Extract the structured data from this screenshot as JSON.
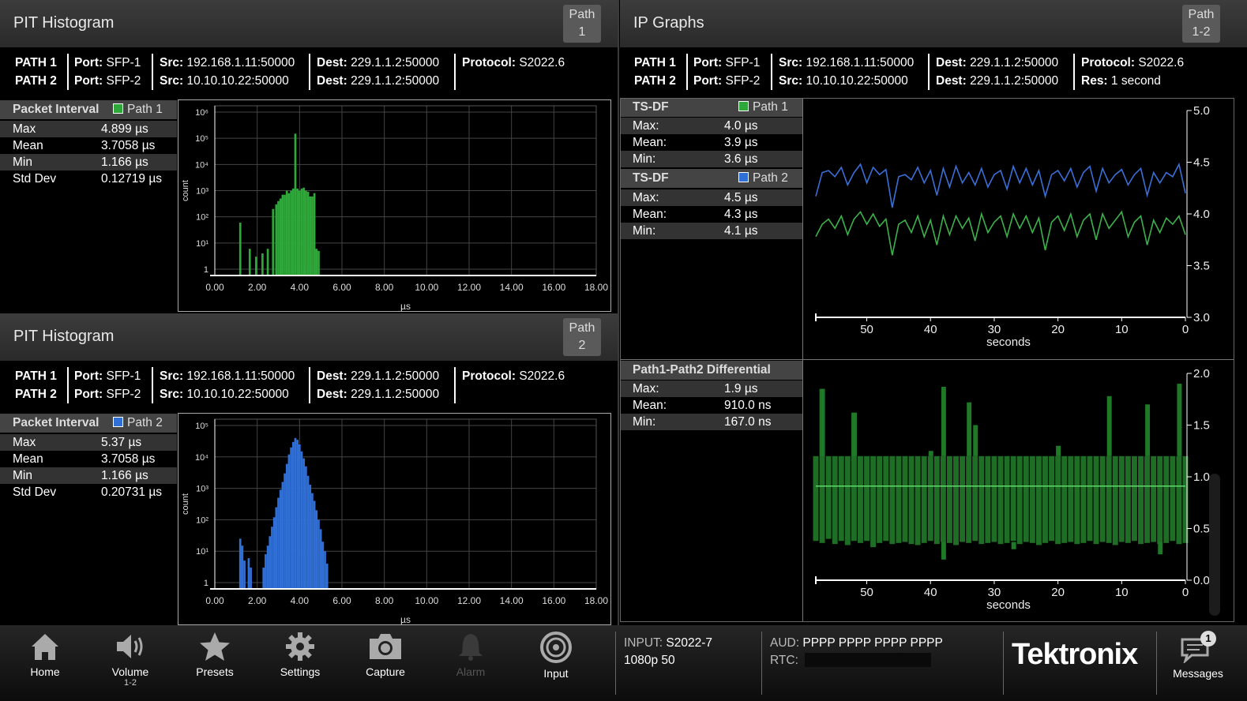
{
  "hist1": {
    "title": "PIT Histogram",
    "path_btn": [
      "Path",
      "1"
    ],
    "info": {
      "p1": {
        "path": "PATH 1",
        "port": "SFP-1",
        "src": "192.168.1.11:50000",
        "dest": "229.1.1.2:50000",
        "extra_label": "Protocol:",
        "extra": "S2022.6"
      },
      "p2": {
        "path": "PATH 2",
        "port": "SFP-2",
        "src": "10.10.10.22:50000",
        "dest": "229.1.1.2:50000"
      }
    },
    "stats_header": "Packet Interval",
    "stats_path": "Path 1",
    "stats": [
      {
        "label": "Max",
        "value": "4.899 µs"
      },
      {
        "label": "Mean",
        "value": "3.7058 µs"
      },
      {
        "label": "Min",
        "value": "1.166 µs"
      },
      {
        "label": "Std Dev",
        "value": "0.12719 µs"
      }
    ]
  },
  "hist2": {
    "title": "PIT Histogram",
    "path_btn": [
      "Path",
      "2"
    ],
    "info": {
      "p1": {
        "path": "PATH 1",
        "port": "SFP-1",
        "src": "192.168.1.11:50000",
        "dest": "229.1.1.2:50000",
        "extra_label": "Protocol:",
        "extra": "S2022.6"
      },
      "p2": {
        "path": "PATH 2",
        "port": "SFP-2",
        "src": "10.10.10.22:50000",
        "dest": "229.1.1.2:50000"
      }
    },
    "stats_header": "Packet Interval",
    "stats_path": "Path 2",
    "stats": [
      {
        "label": "Max",
        "value": "5.37 µs"
      },
      {
        "label": "Mean",
        "value": "3.7058 µs"
      },
      {
        "label": "Min",
        "value": "1.166 µs"
      },
      {
        "label": "Std Dev",
        "value": "0.20731 µs"
      }
    ]
  },
  "ipgraphs": {
    "title": "IP Graphs",
    "path_btn": [
      "Path",
      "1-2"
    ],
    "info": {
      "p1": {
        "path": "PATH 1",
        "port": "SFP-1",
        "src": "192.168.1.11:50000",
        "dest": "229.1.1.2:50000",
        "extra_label": "Protocol:",
        "extra": "S2022.6"
      },
      "p2": {
        "path": "PATH 2",
        "port": "SFP-2",
        "src": "10.10.10.22:50000",
        "dest": "229.1.1.2:50000",
        "extra_label": "Res:",
        "extra": "1 second"
      }
    },
    "tsdf1": {
      "header": "TS-DF",
      "path": "Path 1",
      "stats": [
        {
          "label": "Max:",
          "value": "4.0 µs"
        },
        {
          "label": "Mean:",
          "value": "3.9 µs"
        },
        {
          "label": "Min:",
          "value": "3.6 µs"
        }
      ]
    },
    "tsdf2": {
      "header": "TS-DF",
      "path": "Path 2",
      "stats": [
        {
          "label": "Max:",
          "value": "4.5 µs"
        },
        {
          "label": "Mean:",
          "value": "4.3 µs"
        },
        {
          "label": "Min:",
          "value": "4.1 µs"
        }
      ]
    },
    "diff": {
      "header": "Path1-Path2 Differential",
      "stats": [
        {
          "label": "Max:",
          "value": "1.9 µs"
        },
        {
          "label": "Mean:",
          "value": "910.0 ns"
        },
        {
          "label": "Min:",
          "value": "167.0 ns"
        }
      ]
    }
  },
  "chart_data": [
    {
      "type": "bar",
      "id": "pit-histogram-path1",
      "xlabel": "µs",
      "ylabel": "count",
      "xlim": [
        0,
        18
      ],
      "yscale": "log",
      "ylim": [
        1,
        1000000
      ],
      "xticks": [
        "0.00",
        "2.00",
        "4.00",
        "6.00",
        "8.00",
        "10.00",
        "12.00",
        "14.00",
        "16.00",
        "18.00"
      ],
      "yticks": [
        "1",
        "10¹",
        "10²",
        "10³",
        "10⁴",
        "10⁵",
        "10⁶"
      ],
      "color": "#2fa83a",
      "x": [
        1.2,
        1.65,
        1.95,
        2.25,
        2.5,
        2.75,
        2.9,
        3.0,
        3.1,
        3.2,
        3.3,
        3.4,
        3.5,
        3.6,
        3.7,
        3.8,
        3.9,
        4.0,
        4.1,
        4.2,
        4.3,
        4.4,
        4.5,
        4.6,
        4.7,
        4.8,
        4.9
      ],
      "values": [
        60,
        6,
        3,
        4,
        6,
        200,
        300,
        400,
        500,
        700,
        700,
        1000,
        800,
        1000,
        1200,
        150000,
        1200,
        1000,
        1200,
        1300,
        1000,
        900,
        600,
        600,
        800,
        6,
        5
      ]
    },
    {
      "type": "bar",
      "id": "pit-histogram-path2",
      "xlabel": "µs",
      "ylabel": "count",
      "xlim": [
        0,
        18
      ],
      "yscale": "log",
      "ylim": [
        1,
        100000
      ],
      "xticks": [
        "0.00",
        "2.00",
        "4.00",
        "6.00",
        "8.00",
        "10.00",
        "12.00",
        "14.00",
        "16.00",
        "18.00"
      ],
      "yticks": [
        "1",
        "10¹",
        "10²",
        "10³",
        "10⁴",
        "10⁵"
      ],
      "color": "#2f6fd6",
      "x": [
        1.2,
        1.3,
        1.4,
        1.6,
        1.7,
        2.3,
        2.4,
        2.5,
        2.6,
        2.7,
        2.8,
        2.9,
        3.0,
        3.1,
        3.2,
        3.3,
        3.4,
        3.5,
        3.6,
        3.7,
        3.8,
        3.9,
        4.0,
        4.1,
        4.2,
        4.3,
        4.4,
        4.5,
        4.6,
        4.7,
        4.8,
        4.9,
        5.0,
        5.1,
        5.2,
        5.3
      ],
      "values": [
        25,
        15,
        5,
        6,
        3,
        3,
        8,
        15,
        30,
        60,
        120,
        250,
        500,
        900,
        1600,
        3000,
        6000,
        12000,
        20000,
        30000,
        40000,
        35000,
        25000,
        15000,
        9000,
        5000,
        2500,
        1300,
        700,
        400,
        200,
        100,
        50,
        20,
        10,
        4
      ]
    },
    {
      "type": "line",
      "id": "ts-df-graph",
      "xlabel": "seconds",
      "xlim": [
        58,
        0
      ],
      "ylim": [
        3.0,
        5.0
      ],
      "xticks": [
        "50",
        "40",
        "30",
        "20",
        "10",
        "0"
      ],
      "yticks": [
        "3.0",
        "3.5",
        "4.0",
        "4.5",
        "5.0"
      ],
      "x": [
        58,
        57,
        56,
        55,
        54,
        53,
        52,
        51,
        50,
        49,
        48,
        47,
        46,
        45,
        44,
        43,
        42,
        41,
        40,
        39,
        38,
        37,
        36,
        35,
        34,
        33,
        32,
        31,
        30,
        29,
        28,
        27,
        26,
        25,
        24,
        23,
        22,
        21,
        20,
        19,
        18,
        17,
        16,
        15,
        14,
        13,
        12,
        11,
        10,
        9,
        8,
        7,
        6,
        5,
        4,
        3,
        2,
        1,
        0
      ],
      "series": [
        {
          "color": "#3a6fd8",
          "values": [
            4.17,
            4.4,
            4.42,
            4.36,
            4.45,
            4.28,
            4.4,
            4.48,
            4.3,
            4.45,
            4.38,
            4.43,
            4.06,
            4.36,
            4.38,
            4.33,
            4.45,
            4.3,
            4.42,
            4.18,
            4.44,
            4.26,
            4.46,
            4.3,
            4.4,
            4.28,
            4.44,
            4.26,
            4.38,
            4.42,
            4.24,
            4.46,
            4.3,
            4.44,
            4.28,
            4.42,
            4.17,
            4.38,
            4.42,
            4.32,
            4.44,
            4.26,
            4.4,
            4.46,
            4.22,
            4.44,
            4.3,
            4.38,
            4.43,
            4.28,
            4.38,
            4.44,
            4.18,
            4.4,
            4.3,
            4.4,
            4.36,
            4.48,
            4.2
          ]
        },
        {
          "color": "#3db24a",
          "values": [
            3.78,
            3.9,
            3.95,
            3.86,
            3.98,
            3.8,
            3.95,
            4.02,
            3.9,
            4.0,
            3.88,
            3.95,
            3.6,
            3.9,
            3.94,
            3.82,
            3.98,
            3.78,
            3.94,
            3.7,
            3.98,
            3.8,
            3.98,
            3.86,
            3.96,
            3.74,
            4.0,
            3.82,
            3.92,
            3.98,
            3.78,
            4.0,
            3.86,
            3.98,
            3.82,
            3.96,
            3.65,
            3.92,
            3.98,
            3.84,
            4.0,
            3.78,
            3.94,
            4.0,
            3.75,
            4.0,
            3.86,
            3.94,
            4.02,
            3.78,
            3.92,
            3.98,
            3.7,
            3.94,
            3.82,
            3.96,
            3.9,
            3.98,
            3.8
          ]
        }
      ]
    },
    {
      "type": "bar",
      "id": "path-differential-graph",
      "xlabel": "seconds",
      "xlim": [
        58,
        0
      ],
      "ylim": [
        0.0,
        2.0
      ],
      "xticks": [
        "50",
        "40",
        "30",
        "20",
        "10",
        "0"
      ],
      "yticks": [
        "0.0",
        "0.5",
        "1.0",
        "1.5",
        "2.0"
      ],
      "mean": 0.91,
      "color": "#1f6e26",
      "x": [
        58,
        57,
        56,
        55,
        54,
        53,
        52,
        51,
        50,
        49,
        48,
        47,
        46,
        45,
        44,
        43,
        42,
        41,
        40,
        39,
        38,
        37,
        36,
        35,
        34,
        33,
        32,
        31,
        30,
        29,
        28,
        27,
        26,
        25,
        24,
        23,
        22,
        21,
        20,
        19,
        18,
        17,
        16,
        15,
        14,
        13,
        12,
        11,
        10,
        9,
        8,
        7,
        6,
        5,
        4,
        3,
        2,
        1,
        0
      ],
      "max": [
        1.2,
        1.85,
        1.2,
        1.2,
        1.2,
        1.2,
        1.62,
        1.2,
        1.2,
        1.2,
        1.2,
        1.2,
        1.2,
        1.2,
        1.2,
        1.2,
        1.2,
        1.2,
        1.2,
        1.2,
        1.2,
        1.2,
        1.2,
        1.2,
        1.2,
        1.2,
        1.2,
        1.2,
        1.2,
        1.2,
        1.2,
        1.2,
        1.2,
        1.2,
        1.2,
        1.2,
        1.2,
        1.2,
        1.2,
        1.2,
        1.2,
        1.2,
        1.2,
        1.2,
        1.2,
        1.2,
        1.2,
        1.2,
        1.2,
        1.2,
        1.2,
        1.2,
        1.2,
        1.2,
        1.2,
        1.2,
        1.2,
        1.2,
        1.2
      ],
      "min": [
        0.38,
        0.36,
        0.4,
        0.35,
        0.38,
        0.34,
        0.38,
        0.36,
        0.38,
        0.32,
        0.36,
        0.38,
        0.35,
        0.36,
        0.37,
        0.35,
        0.34,
        0.36,
        0.38,
        0.35,
        0.37,
        0.36,
        0.34,
        0.37,
        0.36,
        0.38,
        0.35,
        0.36,
        0.37,
        0.35,
        0.36,
        0.38,
        0.35,
        0.37,
        0.36,
        0.34,
        0.36,
        0.38,
        0.35,
        0.36,
        0.37,
        0.35,
        0.36,
        0.38,
        0.35,
        0.37,
        0.36,
        0.34,
        0.37,
        0.36,
        0.38,
        0.35,
        0.36,
        0.37,
        0.35,
        0.36,
        0.38,
        0.35,
        0.36
      ],
      "spikes": [
        {
          "x": 57,
          "value": 1.85
        },
        {
          "x": 52,
          "value": 1.62
        },
        {
          "x": 40,
          "value": 1.25
        },
        {
          "x": 38,
          "value": 1.87
        },
        {
          "x": 34,
          "value": 1.72
        },
        {
          "x": 33,
          "value": 1.5
        },
        {
          "x": 20,
          "value": 1.3
        },
        {
          "x": 12,
          "value": 1.78
        },
        {
          "x": 6,
          "value": 1.7
        },
        {
          "x": 1,
          "value": 1.9
        }
      ],
      "dips": [
        {
          "x": 38,
          "value": 0.2
        },
        {
          "x": 27,
          "value": 0.3
        },
        {
          "x": 4,
          "value": 0.25
        }
      ]
    }
  ],
  "bottom": {
    "nav": [
      {
        "label": "Home",
        "icon": "home-icon"
      },
      {
        "label": "Volume",
        "sub": "1-2",
        "icon": "volume-icon"
      },
      {
        "label": "Presets",
        "icon": "star-icon"
      },
      {
        "label": "Settings",
        "icon": "gear-icon"
      },
      {
        "label": "Capture",
        "icon": "camera-icon"
      },
      {
        "label": "Alarm",
        "icon": "bell-icon"
      },
      {
        "label": "Input",
        "icon": "input-icon"
      }
    ],
    "input_label": "INPUT:",
    "input_value": "S2022-7",
    "format": "1080p 50",
    "aud_label": "AUD:",
    "aud_value": "PPPP PPPP PPPP PPPP",
    "rtc_label": "RTC:",
    "logo": "Tektronix",
    "messages_label": "Messages",
    "messages_count": "1"
  }
}
